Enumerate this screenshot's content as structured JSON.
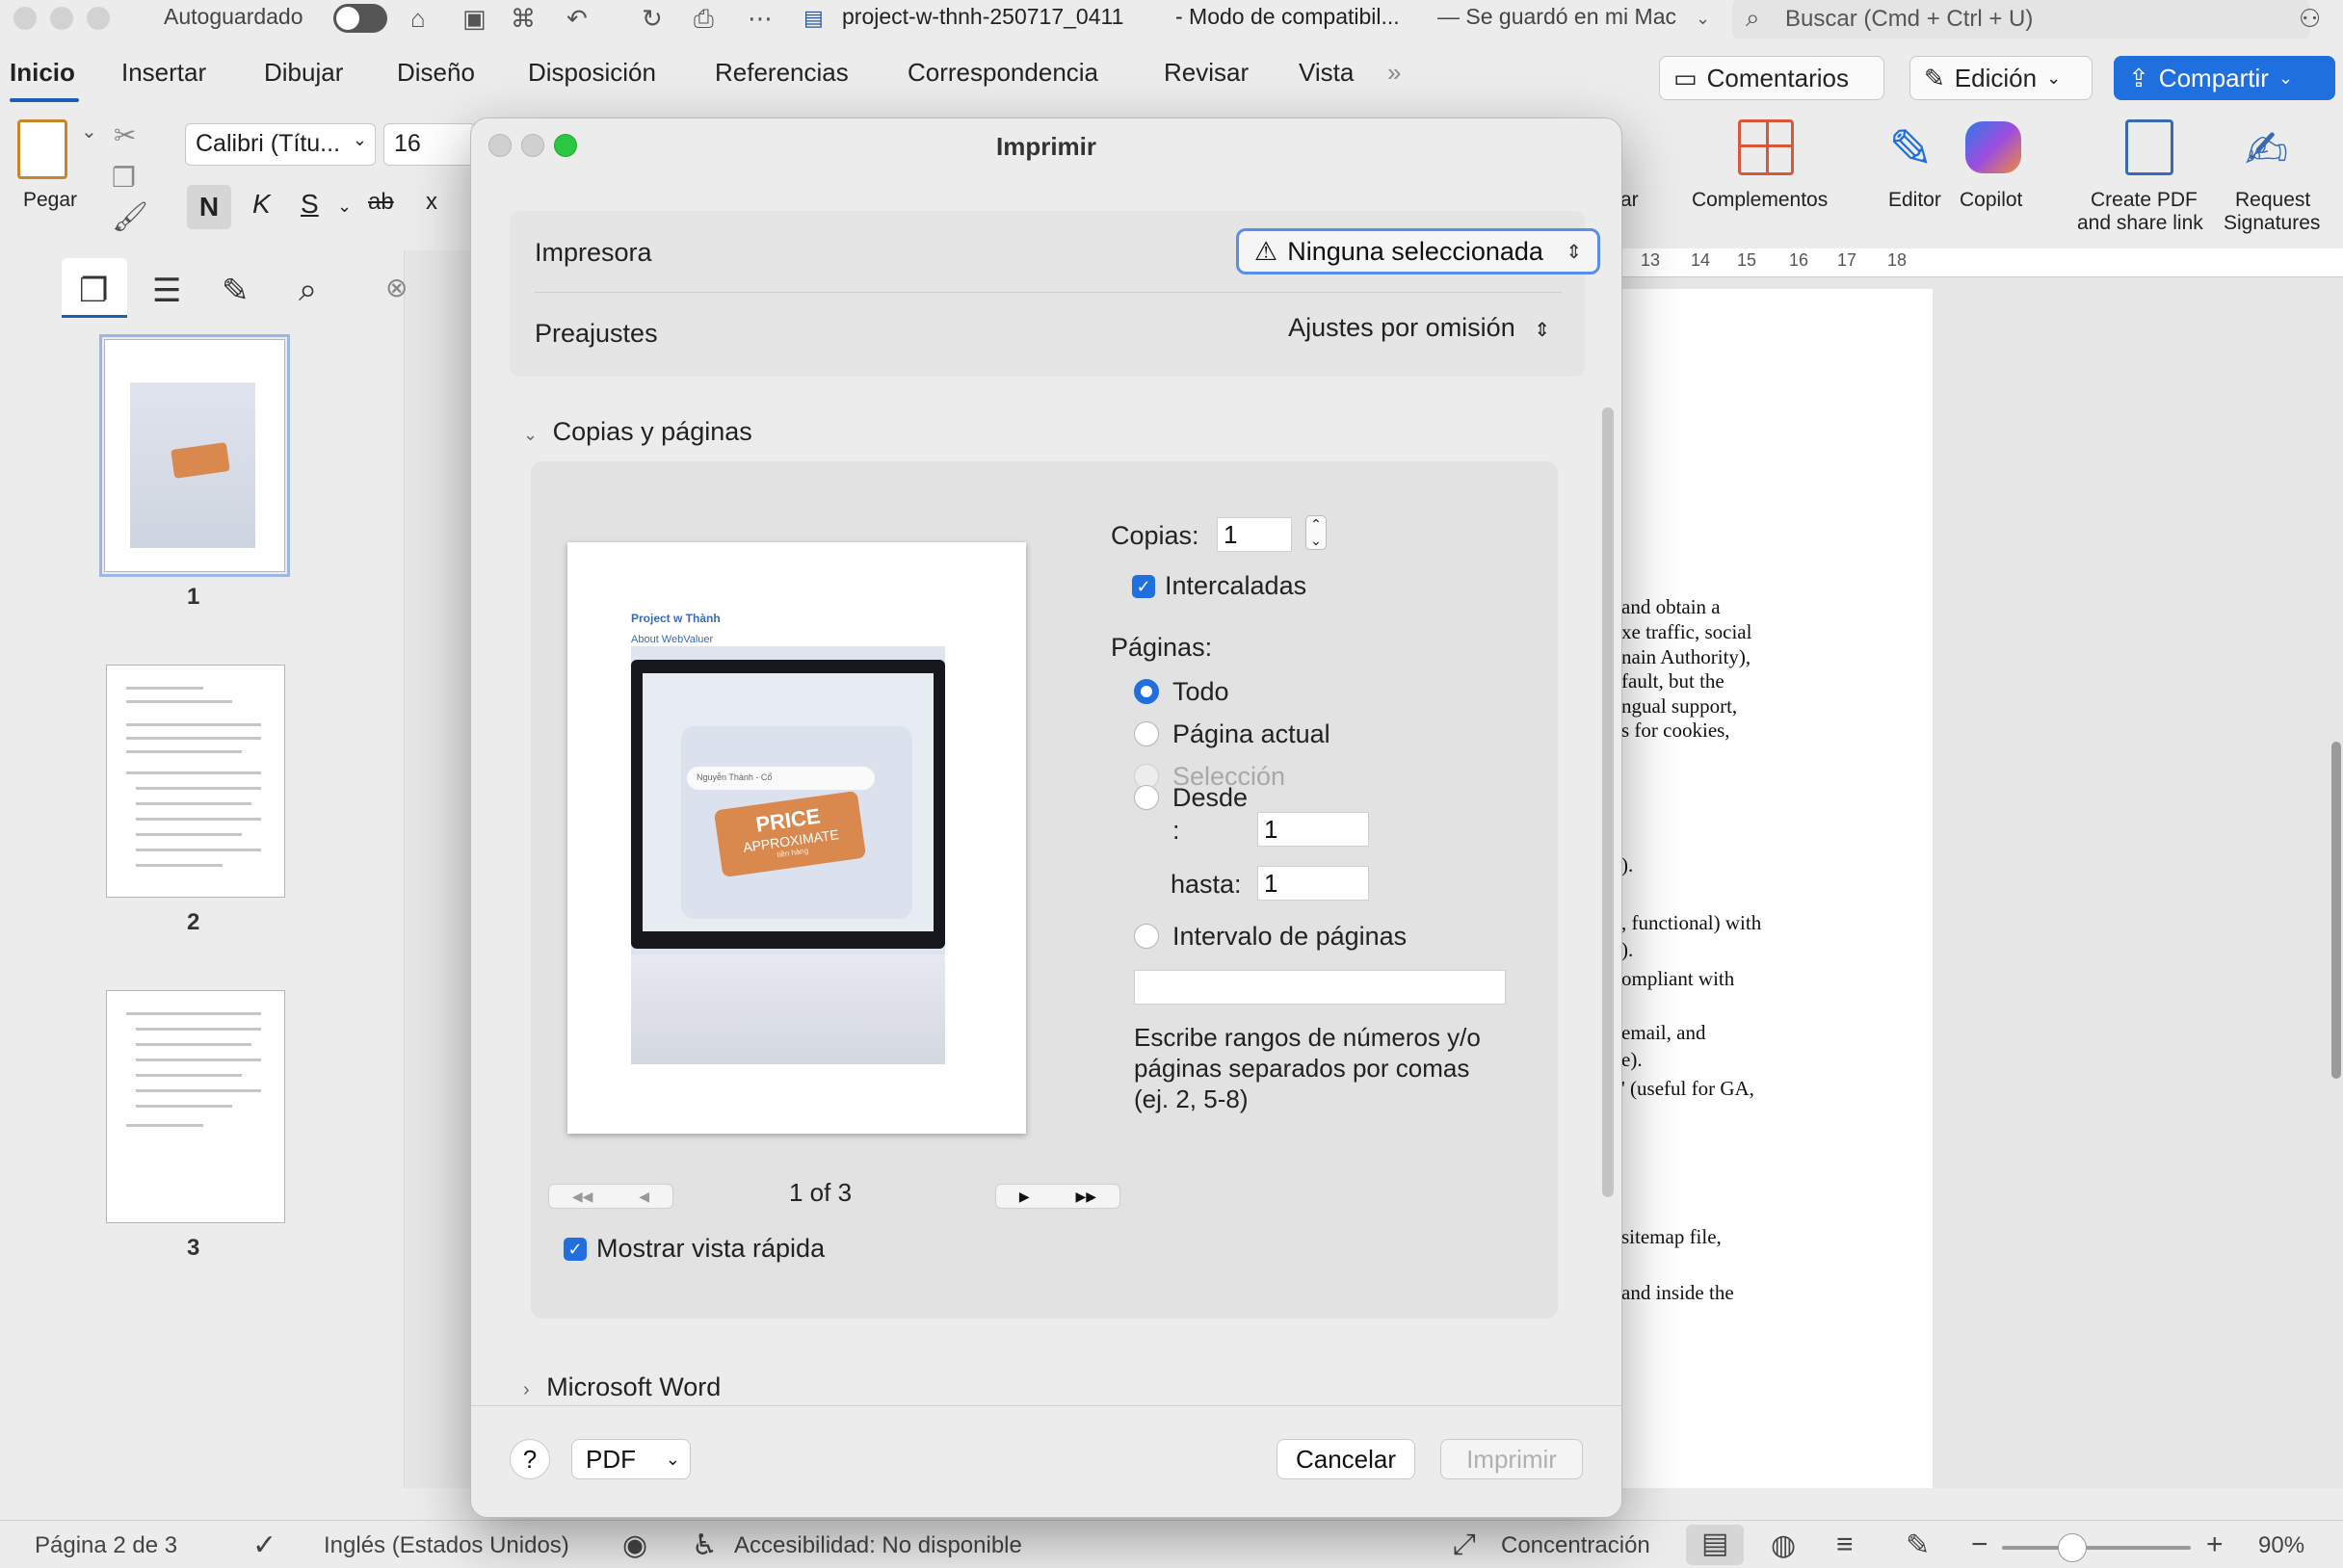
{
  "titlebar": {
    "autosave_label": "Autoguardado",
    "doc_title": "project-w-thnh-250717_0411",
    "mode": "-  Modo de compatibil...",
    "saved": "— Se guardó en mi Mac",
    "search_placeholder": "Buscar (Cmd + Ctrl + U)"
  },
  "tabs": [
    "Inicio",
    "Insertar",
    "Dibujar",
    "Diseño",
    "Disposición",
    "Referencias",
    "Correspondencia",
    "Revisar",
    "Vista"
  ],
  "ribbon_buttons": {
    "comments": "Comentarios",
    "editing": "Edición",
    "share": "Compartir"
  },
  "ribbon": {
    "paste": "Pegar",
    "font_name": "Calibri (Títu...",
    "font_size": "16",
    "bold": "N",
    "italic": "K",
    "strike": "S",
    "strike2": "ab",
    "subscript": "x",
    "addins": "Complementos",
    "editor": "Editor",
    "copilot": "Copilot",
    "create_pdf_1": "Create PDF",
    "create_pdf_2": "and share link",
    "request_1": "Request",
    "request_2": "Signatures",
    "partial_label": "ar"
  },
  "sidebar": {
    "pages": [
      "1",
      "2",
      "3"
    ]
  },
  "ruler": [
    "13",
    "14",
    "15",
    "16",
    "17",
    "18"
  ],
  "doc_lines": [
    "and obtain a",
    "xe traffic, social",
    "nain Authority),",
    "fault, but the",
    "ngual support,",
    "s for cookies,",
    ").",
    ", functional) with",
    ").",
    "ompliant with",
    "email, and",
    "e).",
    "' (useful for GA,",
    "sitemap file,",
    "and inside the"
  ],
  "status": {
    "page": "Página 2 de 3",
    "language": "Inglés (Estados Unidos)",
    "accessibility": "Accesibilidad: No disponible",
    "focus": "Concentración",
    "zoom": "90%",
    "zoom_level": 0.37
  },
  "dialog": {
    "title": "Imprimir",
    "printer_label": "Impresora",
    "printer_value": "Ninguna seleccionada",
    "presets_label": "Preajustes",
    "presets_value": "Ajustes por omisión",
    "section": "Copias y páginas",
    "copies_label": "Copias:",
    "copies_value": "1",
    "collate": "Intercaladas",
    "pages_label": "Páginas:",
    "opt_all": "Todo",
    "opt_current": "Página actual",
    "opt_selection": "Selección",
    "opt_from": "Desde",
    "from_colon": ":",
    "from_value": "1",
    "to_label": "hasta:",
    "to_value": "1",
    "opt_range": "Intervalo de páginas",
    "range_value": "",
    "help": "Escribe rangos de números y/o páginas separados por comas (ej. 2, 5-8)",
    "page_counter": "1 of 3",
    "quick_preview": "Mostrar vista rápida",
    "ms_word": "Microsoft Word",
    "help_btn": "?",
    "pdf": "PDF",
    "cancel": "Cancelar",
    "print": "Imprimir"
  },
  "preview": {
    "title": "Project w Thành",
    "subtitle": "About WebValuer",
    "field": "Nguyễn Thành - Cổ",
    "tag_1": "PRICE",
    "tag_2": "APPROXIMATE",
    "tag_3": "tiền hàng"
  },
  "colors": {
    "accent": "#1f6fde",
    "tab_underline": "#1a5fb4",
    "zoom_green": "#2ac840"
  }
}
